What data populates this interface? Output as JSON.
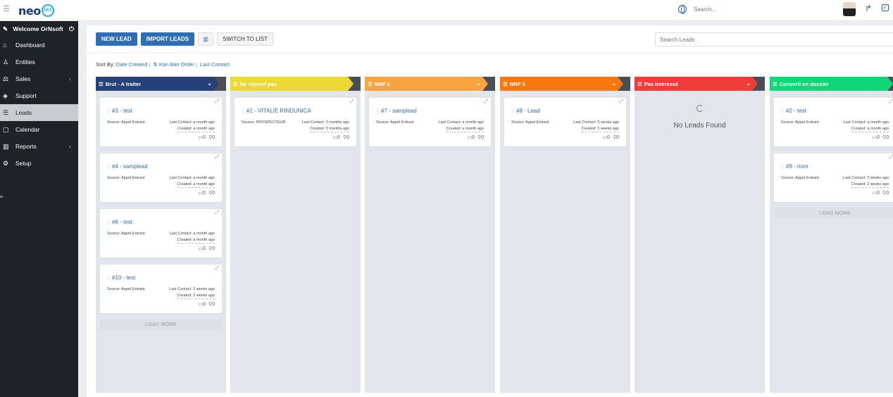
{
  "brand": {
    "logo_text": "neo",
    "logo_badge": "GEE"
  },
  "topbar": {
    "search_placeholder": "Search..."
  },
  "sidebar": {
    "welcome": "Welcome OrNsoft",
    "items": [
      {
        "label": "Dashboard",
        "icon": "home-icon",
        "glyph": "⌂"
      },
      {
        "label": "Entities",
        "icon": "user-icon",
        "glyph": "♙"
      },
      {
        "label": "Sales",
        "icon": "scale-icon",
        "glyph": "⚖",
        "chevron": true
      },
      {
        "label": "Support",
        "icon": "tag-icon",
        "glyph": "◈"
      },
      {
        "label": "Leads",
        "icon": "leads-icon",
        "glyph": "☰",
        "active": true
      },
      {
        "label": "Calendar",
        "icon": "calendar-icon",
        "glyph": "▢"
      },
      {
        "label": "Reports",
        "icon": "chart-icon",
        "glyph": "▥",
        "chevron": true
      },
      {
        "label": "Setup",
        "icon": "gear-icon",
        "glyph": "⚙"
      }
    ]
  },
  "toolbar": {
    "new_lead": "NEW LEAD",
    "import_leads": "IMPORT LEADS",
    "switch_list": "SWITCH TO LIST",
    "search_placeholder": "Search Leads"
  },
  "sort": {
    "prefix": "Sort By:",
    "date_created": "Date Created",
    "kanban_order": "Kan Ban Order",
    "last_contact": "Last Contact"
  },
  "colors": {
    "brut": "#26407a",
    "ne_repond": "#ecd933",
    "nrp2": "#f7a440",
    "nrp3": "#f7780f",
    "pas_interesse": "#f13c3c",
    "converti": "#11d677",
    "primary": "#2f6db4"
  },
  "columns": [
    {
      "key": "brut",
      "title": "Brut - A traiter",
      "has_chevron": true,
      "cards": [
        {
          "title": "#3 - test",
          "source": "Source: Appel Entrant",
          "last_contact": "Last Contact: a month ago",
          "created": "Created: a month ago",
          "notes": "0",
          "attachments": "0"
        },
        {
          "title": "#4 - samplead",
          "source": "Source: Appel Entrant",
          "last_contact": "Last Contact: a month ago",
          "created": "Created: a month ago",
          "notes": "0",
          "attachments": "0"
        },
        {
          "title": "#6 - test",
          "source": "Source: Appel Entrant",
          "last_contact": "Last Contact: a month ago",
          "created": "Created: a month ago",
          "notes": "0",
          "attachments": "0"
        },
        {
          "title": "#10 - test",
          "source": "Source: Appel Entrant",
          "last_contact": "Last Contact: 2 weeks ago",
          "created": "Created: 2 weeks ago",
          "notes": "0",
          "attachments": "0"
        }
      ],
      "load_more": "LOAD MORE"
    },
    {
      "key": "ne_repond",
      "title": "Ne répond pas",
      "has_chevron": false,
      "cards": [
        {
          "title": "#1 - VITALIE RINDUNICA",
          "source": "Source: PROSPECTEUR",
          "last_contact": "Last Contact: 3 months ago",
          "created": "Created: 3 months ago",
          "notes": "0",
          "attachments": "0"
        }
      ]
    },
    {
      "key": "nrp2",
      "title": "NRP 2",
      "has_chevron": true,
      "cards": [
        {
          "title": "#7 - samplead",
          "source": "Source: Appel Entrant",
          "last_contact": "Last Contact: a month ago",
          "created": "Created: a month ago",
          "notes": "0",
          "attachments": "0"
        }
      ]
    },
    {
      "key": "nrp3",
      "title": "NRP 3",
      "has_chevron": true,
      "cards": [
        {
          "title": "#8 - Lead",
          "source": "Source: Appel Entrant",
          "last_contact": "Last Contact: 3 weeks ago",
          "created": "Created: 3 weeks ago",
          "notes": "0",
          "attachments": "0"
        }
      ]
    },
    {
      "key": "pas_interesse",
      "title": "Pas Interessé",
      "has_chevron": true,
      "cards": [],
      "empty": "No Leads Found"
    },
    {
      "key": "converti",
      "title": "Converti en dossier",
      "has_chevron": false,
      "cards": [
        {
          "title": "#2 - test",
          "source": "Source: Appel Entrant",
          "last_contact": "Last Contact: a month ago",
          "created": "Created: a month ago",
          "notes": "0",
          "attachments": "0"
        },
        {
          "title": "#9 - nom",
          "source": "Source: Appel Entrant",
          "last_contact": "Last Contact: 2 weeks ago",
          "created": "Created: 2 weeks ago",
          "notes": "0",
          "attachments": "0"
        }
      ],
      "load_more": "LOAD MORE"
    }
  ]
}
